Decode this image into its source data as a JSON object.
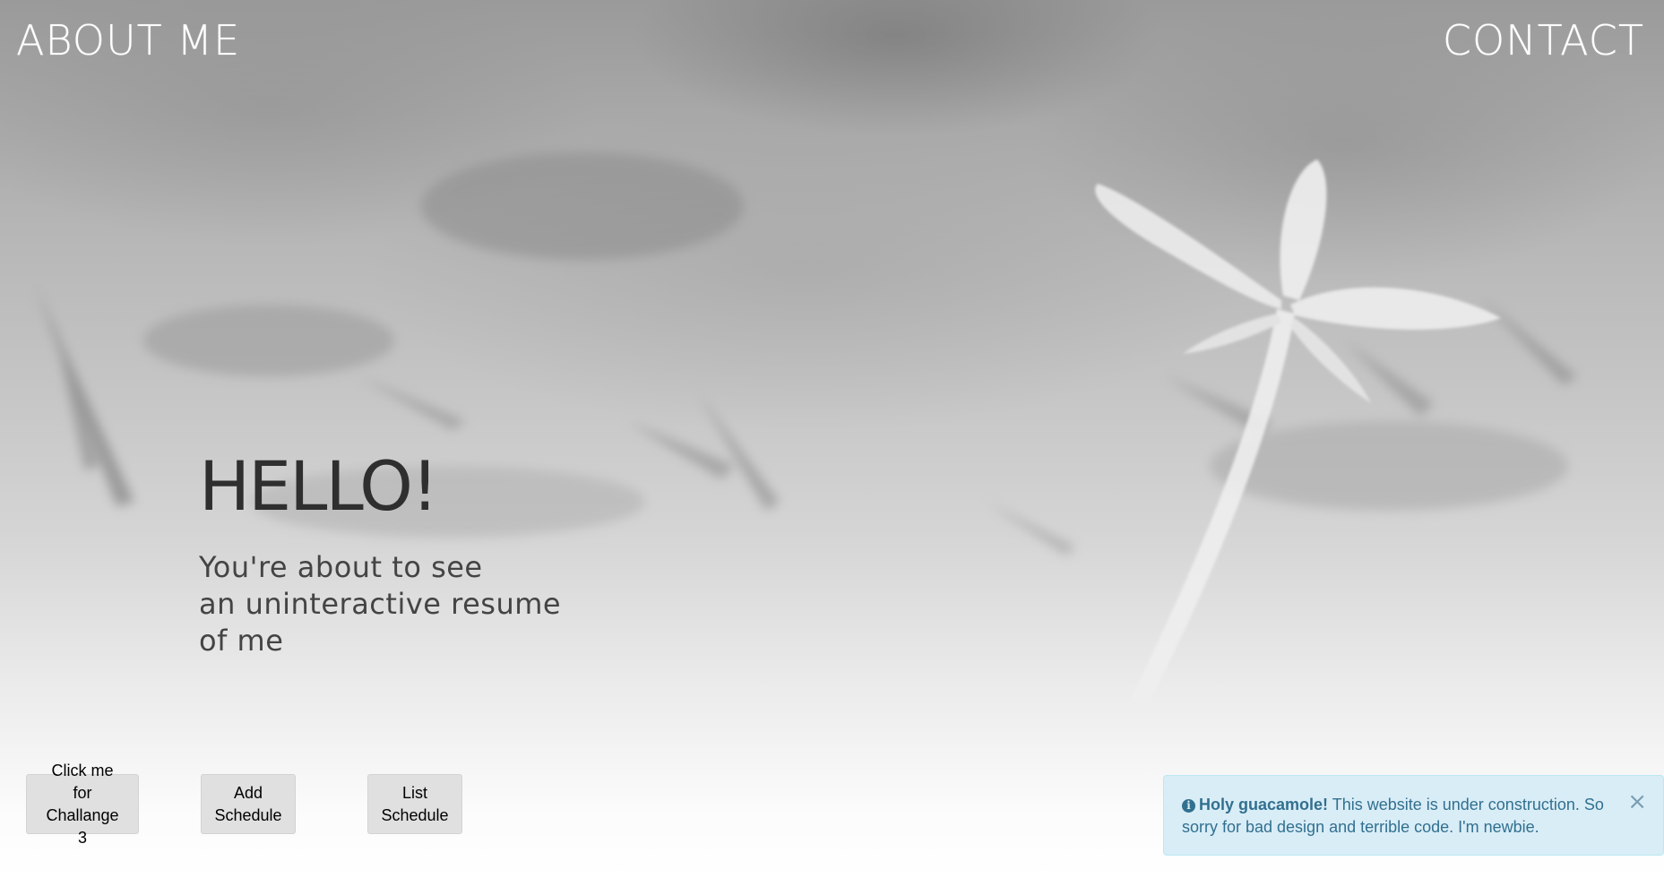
{
  "nav": {
    "about_label": "ABOUT ME",
    "contact_label": "CONTACT"
  },
  "hero": {
    "title": "HELLO!",
    "subtitle_lines": [
      "You're about to see",
      "an uninteractive resume",
      "of me"
    ]
  },
  "buttons": {
    "challenge": [
      "Click me for",
      "Challange 3"
    ],
    "add_schedule": [
      "Add",
      "Schedule"
    ],
    "list_schedule": [
      "List",
      "Schedule"
    ]
  },
  "alert": {
    "icon": "info-circle-icon",
    "heading": "Holy guacamole!",
    "message": " This website is under construction. So sorry for bad design and terrible code. I'm newbie.",
    "close_symbol": "×",
    "colors": {
      "background": "#d9edf7",
      "text": "#31708f",
      "border": "#bce8f1"
    }
  },
  "background": {
    "image": "blurred grass with white flower photo (grayscale)"
  }
}
